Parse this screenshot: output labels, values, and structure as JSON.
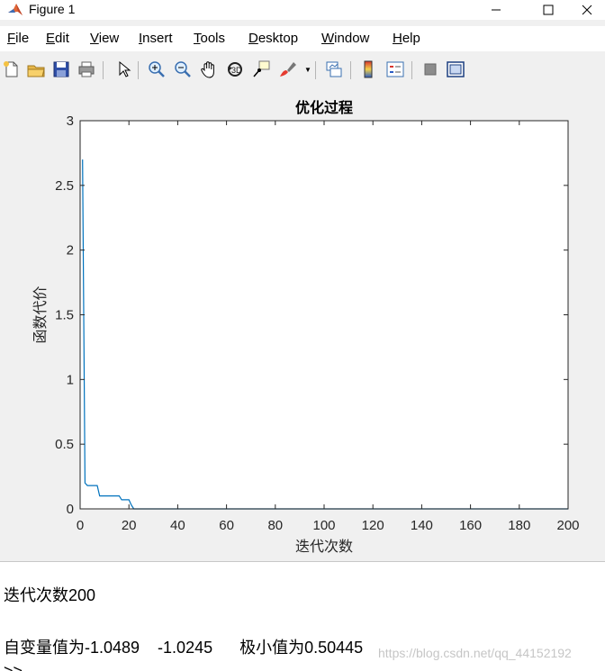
{
  "window": {
    "title": "Figure 1",
    "minimize_glyph": "—",
    "maximize_glyph": "☐",
    "close_glyph": "✕"
  },
  "menu": [
    {
      "label": "File",
      "underline_index": 0
    },
    {
      "label": "Edit",
      "underline_index": 0
    },
    {
      "label": "View",
      "underline_index": 0
    },
    {
      "label": "Insert",
      "underline_index": 0
    },
    {
      "label": "Tools",
      "underline_index": 0
    },
    {
      "label": "Desktop",
      "underline_index": 0
    },
    {
      "label": "Window",
      "underline_index": 0
    },
    {
      "label": "Help",
      "underline_index": 0
    }
  ],
  "toolbar": [
    {
      "icon": "new-figure-icon"
    },
    {
      "icon": "open-file-icon"
    },
    {
      "icon": "save-icon"
    },
    {
      "icon": "print-icon"
    },
    {
      "icon": "edit-plot-arrow-icon"
    },
    {
      "icon": "zoom-in-icon"
    },
    {
      "icon": "zoom-out-icon"
    },
    {
      "icon": "pan-hand-icon"
    },
    {
      "icon": "rotate-3d-icon"
    },
    {
      "icon": "data-cursor-icon"
    },
    {
      "icon": "brush-icon"
    },
    {
      "icon": "link-plot-icon"
    },
    {
      "icon": "colorbar-icon"
    },
    {
      "icon": "legend-icon"
    },
    {
      "icon": "hide-plot-tools-icon"
    },
    {
      "icon": "show-plot-tools-icon"
    }
  ],
  "chart_data": {
    "type": "line",
    "title": "优化过程",
    "xlabel": "迭代次数",
    "ylabel": "函数代价",
    "xlim": [
      0,
      200
    ],
    "ylim": [
      0,
      3
    ],
    "xticks": [
      0,
      20,
      40,
      60,
      80,
      100,
      120,
      140,
      160,
      180,
      200
    ],
    "yticks": [
      0,
      0.5,
      1,
      1.5,
      2,
      2.5,
      3
    ],
    "ytick_labels": [
      "0",
      "0.5",
      "1",
      "1.5",
      "2",
      "2.5",
      "3"
    ],
    "grid": false,
    "color": "#0072bd",
    "series": [
      {
        "x": [
          1,
          2,
          3,
          5,
          7,
          8,
          12,
          16,
          17,
          20,
          21,
          22,
          23,
          30,
          50,
          100,
          150,
          200
        ],
        "y": [
          2.7,
          0.2,
          0.18,
          0.18,
          0.18,
          0.1,
          0.1,
          0.1,
          0.07,
          0.07,
          0.03,
          0.0,
          0.0,
          0.0,
          0.0,
          0.0,
          0.0,
          0.0
        ]
      }
    ]
  },
  "console": {
    "line1": "迭代次数200",
    "line2": "自变量值为-1.0489    -1.0245      极小值为0.50445",
    "line3": ">>",
    "watermark": "https://blog.csdn.net/qq_44152192"
  }
}
